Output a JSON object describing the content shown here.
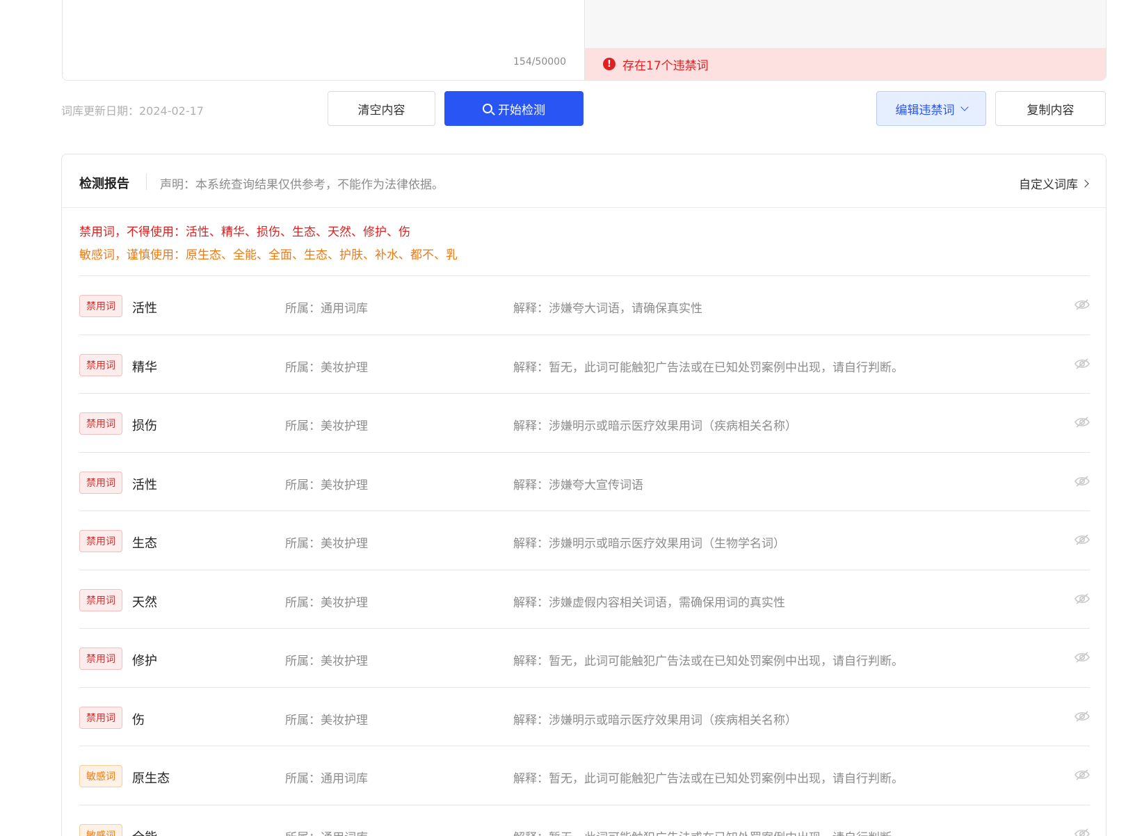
{
  "editor": {
    "char_count": "154/50000",
    "violation_text": "存在17个违禁词"
  },
  "toolbar": {
    "update_date": "词库更新日期：2024-02-17",
    "clear_label": "清空内容",
    "detect_label": "开始检测",
    "edit_label": "编辑违禁词",
    "copy_label": "复制内容"
  },
  "report": {
    "title": "检测报告",
    "disclaimer": "声明：本系统查询结果仅供参考，不能作为法律依据。",
    "custom_lib": "自定义词库",
    "banned_summary": "禁用词，不得使用：活性、精华、损伤、生态、天然、修护、伤",
    "sensitive_summary": "敏感词，谨慎使用：原生态、全能、全面、生态、护肤、补水、都不、乳",
    "rows": [
      {
        "tag": "禁用词",
        "type": "banned",
        "word": "活性",
        "category": "所属：通用词库",
        "explain": "解释：涉嫌夸大词语，请确保真实性"
      },
      {
        "tag": "禁用词",
        "type": "banned",
        "word": "精华",
        "category": "所属：美妆护理",
        "explain": "解释：暂无，此词可能触犯广告法或在已知处罚案例中出现，请自行判断。"
      },
      {
        "tag": "禁用词",
        "type": "banned",
        "word": "损伤",
        "category": "所属：美妆护理",
        "explain": "解释：涉嫌明示或暗示医疗效果用词（疾病相关名称）"
      },
      {
        "tag": "禁用词",
        "type": "banned",
        "word": "活性",
        "category": "所属：美妆护理",
        "explain": "解释：涉嫌夸大宣传词语"
      },
      {
        "tag": "禁用词",
        "type": "banned",
        "word": "生态",
        "category": "所属：美妆护理",
        "explain": "解释：涉嫌明示或暗示医疗效果用词（生物学名词）"
      },
      {
        "tag": "禁用词",
        "type": "banned",
        "word": "天然",
        "category": "所属：美妆护理",
        "explain": "解释：涉嫌虚假内容相关词语，需确保用词的真实性"
      },
      {
        "tag": "禁用词",
        "type": "banned",
        "word": "修护",
        "category": "所属：美妆护理",
        "explain": "解释：暂无，此词可能触犯广告法或在已知处罚案例中出现，请自行判断。"
      },
      {
        "tag": "禁用词",
        "type": "banned",
        "word": "伤",
        "category": "所属：美妆护理",
        "explain": "解释：涉嫌明示或暗示医疗效果用词（疾病相关名称）"
      },
      {
        "tag": "敏感词",
        "type": "sensitive",
        "word": "原生态",
        "category": "所属：通用词库",
        "explain": "解释：暂无，此词可能触犯广告法或在已知处罚案例中出现，请自行判断。"
      },
      {
        "tag": "敏感词",
        "type": "sensitive",
        "word": "全能",
        "category": "所属：通用词库",
        "explain": "解释：暂无，此词可能触犯广告法或在已知处罚案例中出现，请自行判断。"
      }
    ]
  },
  "icons": {
    "alert": "exclamation-circle-icon",
    "search": "search-icon",
    "chevron_down": "chevron-down-icon",
    "chevron_right": "chevron-right-icon",
    "eye_off": "eye-off-icon"
  },
  "colors": {
    "primary": "#2a55f5",
    "banned": "#e02020",
    "sensitive": "#f07a12"
  }
}
